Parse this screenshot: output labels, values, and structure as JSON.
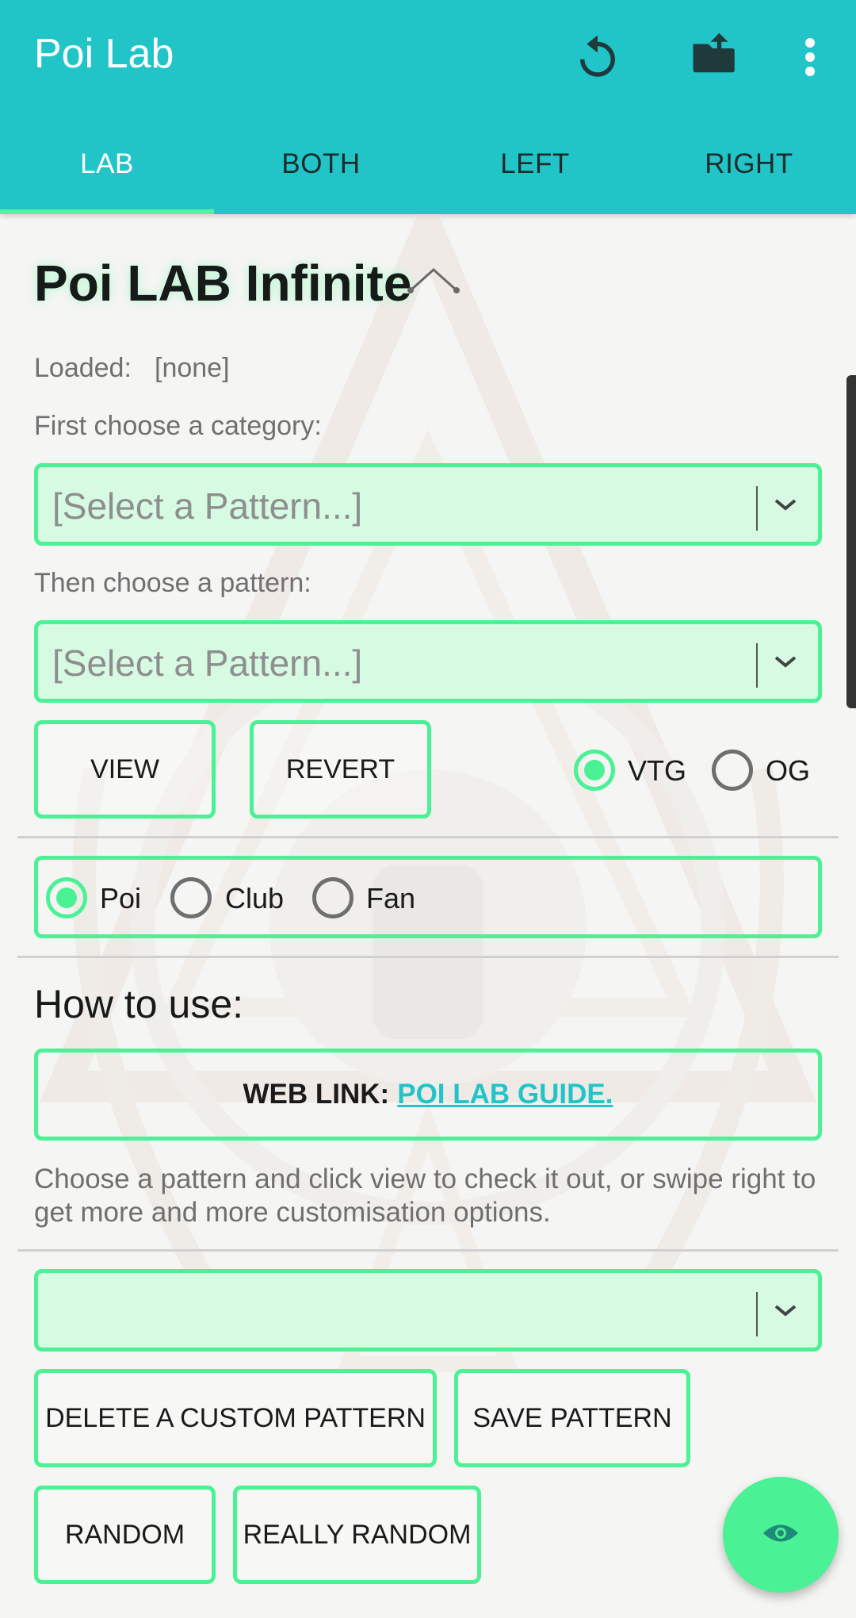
{
  "app": {
    "title": "Poi Lab"
  },
  "toolbar": {
    "icons": [
      "refresh-icon",
      "folder-upload-icon",
      "more-vert-icon"
    ]
  },
  "tabs": [
    {
      "label": "LAB",
      "active": true
    },
    {
      "label": "BOTH",
      "active": false
    },
    {
      "label": "LEFT",
      "active": false
    },
    {
      "label": "RIGHT",
      "active": false
    }
  ],
  "main": {
    "heading": "Poi LAB Infinite",
    "loaded_label": "Loaded:",
    "loaded_value": "[none]",
    "category_label": "First choose a category:",
    "category_select": {
      "placeholder": "[Select a Pattern...]"
    },
    "pattern_label": "Then choose a pattern:",
    "pattern_select": {
      "placeholder": "[Select a Pattern...]"
    },
    "view_button": "VIEW",
    "revert_button": "REVERT",
    "style_options": [
      {
        "label": "VTG",
        "checked": true
      },
      {
        "label": "OG",
        "checked": false
      }
    ],
    "prop_options": [
      {
        "label": "Poi",
        "checked": true
      },
      {
        "label": "Club",
        "checked": false
      },
      {
        "label": "Fan",
        "checked": false
      }
    ],
    "howto_title": "How to use:",
    "weblink_label": "WEB LINK:",
    "weblink_text": "POI LAB GUIDE.",
    "description": "Choose a pattern and click view to check it out, or swipe right to get more and more customisation options.",
    "custom_select": {
      "placeholder": ""
    },
    "delete_button": "DELETE A CUSTOM PATTERN",
    "save_button": "SAVE PATTERN",
    "random_button": "RANDOM",
    "really_random_button": "REALLY RANDOM"
  },
  "fab": {
    "icon": "eye-icon"
  },
  "colors": {
    "primary": "#21c5c8",
    "accent": "#4af195",
    "select_bg": "#d6fbe2"
  }
}
